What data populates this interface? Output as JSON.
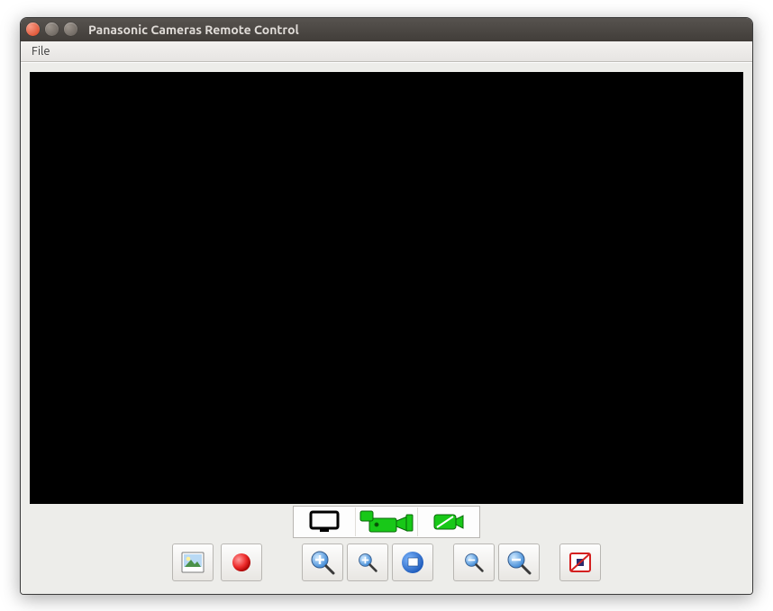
{
  "window": {
    "title": "Panasonic Cameras Remote Control"
  },
  "menubar": {
    "file": "File"
  },
  "modes": {
    "monitor": "monitor",
    "camcorder": "camcorder",
    "camera_off": "camera-off"
  },
  "toolbar": {
    "snapshot": "Snapshot",
    "record": "Record",
    "zoom_in_fast": "Zoom In Fast",
    "zoom_in": "Zoom In",
    "zoom_reset": "Zoom Reset",
    "zoom_out": "Zoom Out",
    "zoom_out_fast": "Zoom Out Fast",
    "stop": "Stop Recording"
  }
}
